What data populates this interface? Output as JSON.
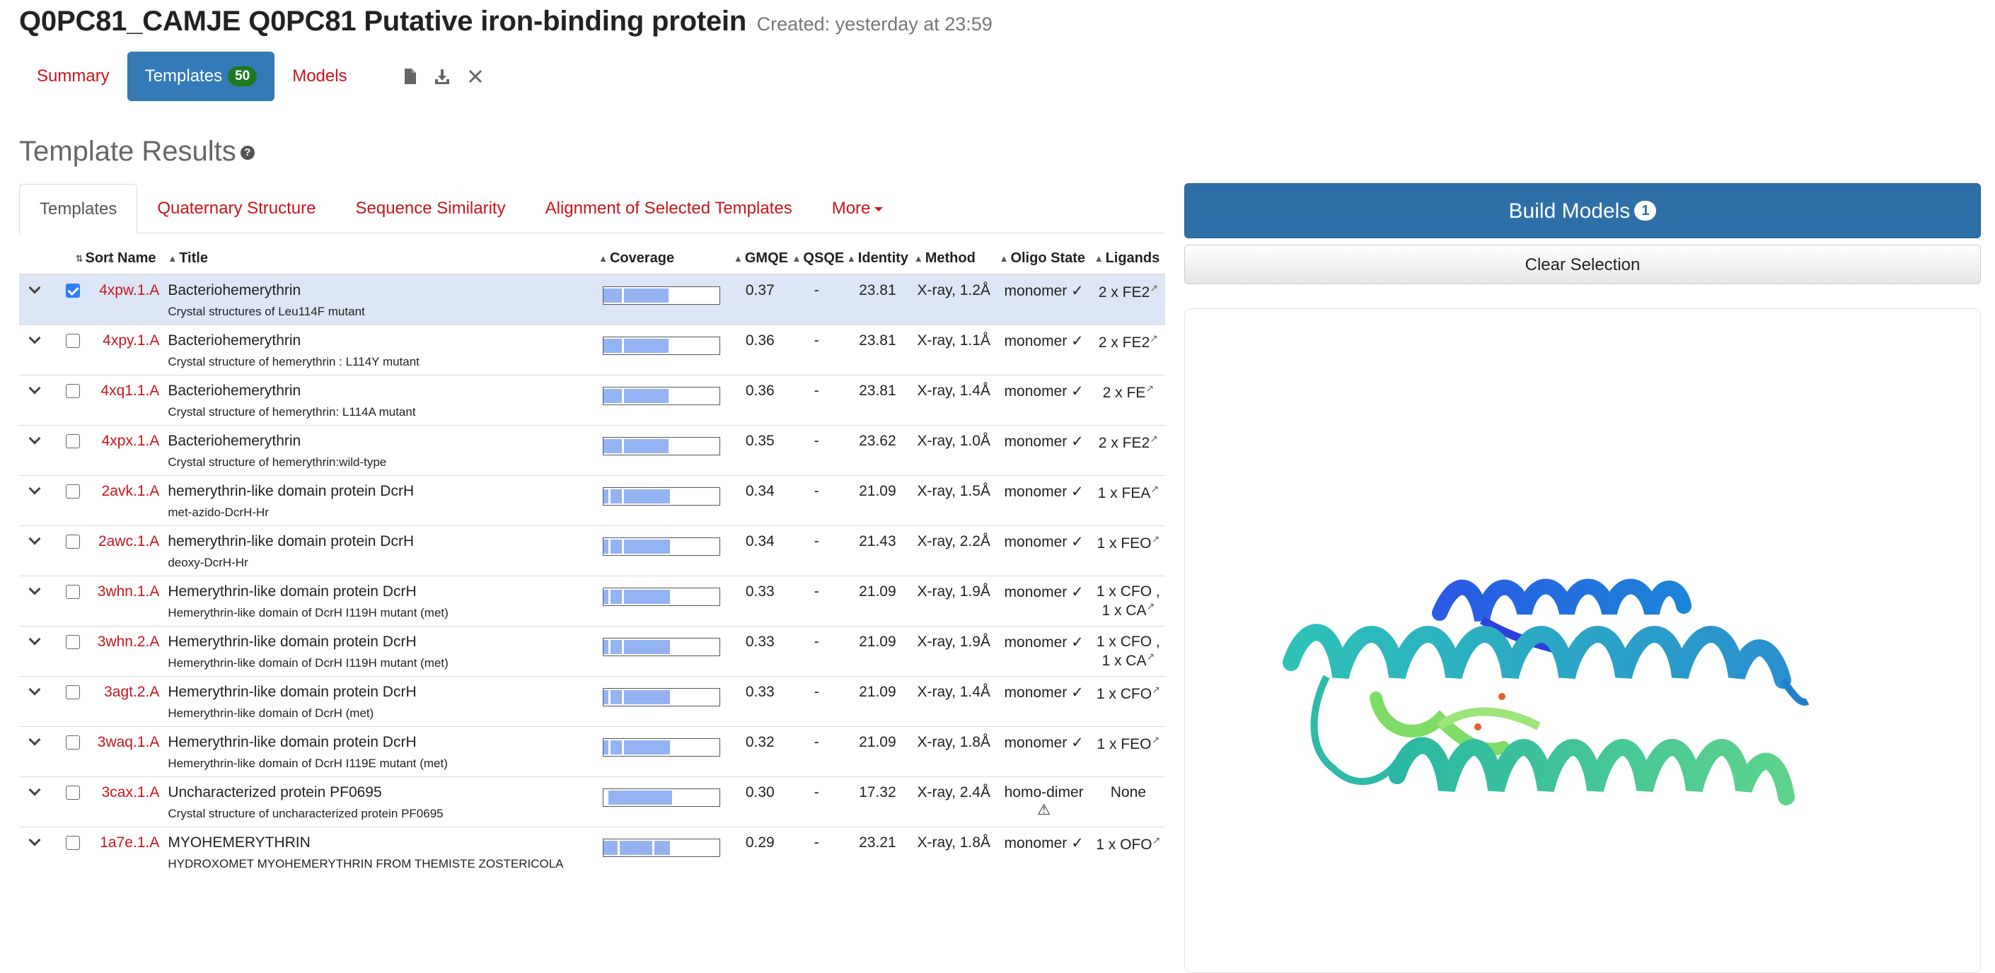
{
  "header": {
    "title": "Q0PC81_CAMJE Q0PC81 Putative iron-binding protein",
    "created": "Created: yesterday at 23:59"
  },
  "nav": {
    "summary": "Summary",
    "templates": "Templates",
    "templates_count": "50",
    "models": "Models",
    "icons": [
      "file-icon",
      "download-icon",
      "close-icon"
    ]
  },
  "section": {
    "title": "Template Results",
    "help": "?"
  },
  "tabs": [
    "Templates",
    "Quaternary Structure",
    "Sequence Similarity",
    "Alignment of Selected Templates",
    "More"
  ],
  "table": {
    "headers": {
      "sort": "Sort",
      "name": "Name",
      "title": "Title",
      "coverage": "Coverage",
      "gmqe": "GMQE",
      "qsqe": "QSQE",
      "identity": "Identity",
      "method": "Method",
      "oligo": "Oligo State",
      "ligands": "Ligands"
    },
    "rows": [
      {
        "name": "4xpw.1.A",
        "title": "Bacteriohemerythrin",
        "subtitle": "Crystal structures of Leu114F mutant",
        "gmqe": "0.37",
        "qsqe": "-",
        "identity": "23.81",
        "method": "X-ray, 1.2Å",
        "oligo": "monomer ✓",
        "ligands": "2 x FE2",
        "selected": true,
        "coverage": {
          "start": 0.0,
          "end": 0.56,
          "gaps": [
            0.16
          ]
        }
      },
      {
        "name": "4xpy.1.A",
        "title": "Bacteriohemerythrin",
        "subtitle": "Crystal structure of hemerythrin : L114Y mutant",
        "gmqe": "0.36",
        "qsqe": "-",
        "identity": "23.81",
        "method": "X-ray, 1.1Å",
        "oligo": "monomer ✓",
        "ligands": "2 x FE2",
        "selected": false,
        "coverage": {
          "start": 0.0,
          "end": 0.56,
          "gaps": [
            0.16
          ]
        }
      },
      {
        "name": "4xq1.1.A",
        "title": "Bacteriohemerythrin",
        "subtitle": "Crystal structure of hemerythrin: L114A mutant",
        "gmqe": "0.36",
        "qsqe": "-",
        "identity": "23.81",
        "method": "X-ray, 1.4Å",
        "oligo": "monomer ✓",
        "ligands": "2 x FE",
        "selected": false,
        "coverage": {
          "start": 0.0,
          "end": 0.56,
          "gaps": [
            0.16
          ]
        }
      },
      {
        "name": "4xpx.1.A",
        "title": "Bacteriohemerythrin",
        "subtitle": "Crystal structure of hemerythrin:wild-type",
        "gmqe": "0.35",
        "qsqe": "-",
        "identity": "23.62",
        "method": "X-ray, 1.0Å",
        "oligo": "monomer ✓",
        "ligands": "2 x FE2",
        "selected": false,
        "coverage": {
          "start": 0.0,
          "end": 0.56,
          "gaps": [
            0.16
          ]
        }
      },
      {
        "name": "2avk.1.A",
        "title": "hemerythrin-like domain protein DcrH",
        "subtitle": "met-azido-DcrH-Hr",
        "gmqe": "0.34",
        "qsqe": "-",
        "identity": "21.09",
        "method": "X-ray, 1.5Å",
        "oligo": "monomer ✓",
        "ligands": "1 x FEA",
        "selected": false,
        "coverage": {
          "start": 0.0,
          "end": 0.57,
          "gaps": [
            0.04,
            0.16
          ]
        }
      },
      {
        "name": "2awc.1.A",
        "title": "hemerythrin-like domain protein DcrH",
        "subtitle": "deoxy-DcrH-Hr",
        "gmqe": "0.34",
        "qsqe": "-",
        "identity": "21.43",
        "method": "X-ray, 2.2Å",
        "oligo": "monomer ✓",
        "ligands": "1 x FEO",
        "selected": false,
        "coverage": {
          "start": 0.0,
          "end": 0.57,
          "gaps": [
            0.04,
            0.16
          ]
        }
      },
      {
        "name": "3whn.1.A",
        "title": "Hemerythrin-like domain protein DcrH",
        "subtitle": "Hemerythrin-like domain of DcrH I119H mutant (met)",
        "gmqe": "0.33",
        "qsqe": "-",
        "identity": "21.09",
        "method": "X-ray, 1.9Å",
        "oligo": "monomer ✓",
        "ligands": "1 x CFO , 1 x CA",
        "selected": false,
        "coverage": {
          "start": 0.0,
          "end": 0.57,
          "gaps": [
            0.04,
            0.16
          ]
        }
      },
      {
        "name": "3whn.2.A",
        "title": "Hemerythrin-like domain protein DcrH",
        "subtitle": "Hemerythrin-like domain of DcrH I119H mutant (met)",
        "gmqe": "0.33",
        "qsqe": "-",
        "identity": "21.09",
        "method": "X-ray, 1.9Å",
        "oligo": "monomer ✓",
        "ligands": "1 x CFO , 1 x CA",
        "selected": false,
        "coverage": {
          "start": 0.0,
          "end": 0.57,
          "gaps": [
            0.04,
            0.16
          ]
        }
      },
      {
        "name": "3agt.2.A",
        "title": "Hemerythrin-like domain protein DcrH",
        "subtitle": "Hemerythrin-like domain of DcrH (met)",
        "gmqe": "0.33",
        "qsqe": "-",
        "identity": "21.09",
        "method": "X-ray, 1.4Å",
        "oligo": "monomer ✓",
        "ligands": "1 x CFO",
        "selected": false,
        "coverage": {
          "start": 0.0,
          "end": 0.57,
          "gaps": [
            0.04,
            0.16
          ]
        }
      },
      {
        "name": "3waq.1.A",
        "title": "Hemerythrin-like domain protein DcrH",
        "subtitle": "Hemerythrin-like domain of DcrH I119E mutant (met)",
        "gmqe": "0.32",
        "qsqe": "-",
        "identity": "21.09",
        "method": "X-ray, 1.8Å",
        "oligo": "monomer ✓",
        "ligands": "1 x FEO",
        "selected": false,
        "coverage": {
          "start": 0.0,
          "end": 0.57,
          "gaps": [
            0.04,
            0.16
          ]
        }
      },
      {
        "name": "3cax.1.A",
        "title": "Uncharacterized protein PF0695",
        "subtitle": "Crystal structure of uncharacterized protein PF0695",
        "gmqe": "0.30",
        "qsqe": "-",
        "identity": "17.32",
        "method": "X-ray, 2.4Å",
        "oligo": "homo-dimer ⚠",
        "ligands": "None",
        "selected": false,
        "coverage": {
          "start": 0.04,
          "end": 0.59,
          "gaps": []
        }
      },
      {
        "name": "1a7e.1.A",
        "title": "MYOHEMERYTHRIN",
        "subtitle": "HYDROXOMET MYOHEMERYTHRIN FROM THEMISTE ZOSTERICOLA",
        "gmqe": "0.29",
        "qsqe": "-",
        "identity": "23.21",
        "method": "X-ray, 1.8Å",
        "oligo": "monomer ✓",
        "ligands": "1 x OFO",
        "selected": false,
        "coverage": {
          "start": 0.0,
          "end": 0.57,
          "gaps": [
            0.12,
            0.42
          ]
        }
      }
    ]
  },
  "actions": {
    "build": "Build Models",
    "build_count": "1",
    "clear": "Clear Selection"
  },
  "viewer": {
    "icon": "protein-structure-3d-view"
  },
  "colors": {
    "accent": "#337ab7",
    "link": "#c9141e",
    "selected_row": "#dde6f6",
    "coverage_fill": "#93b3f2",
    "badge_green": "#1f7a1f"
  }
}
